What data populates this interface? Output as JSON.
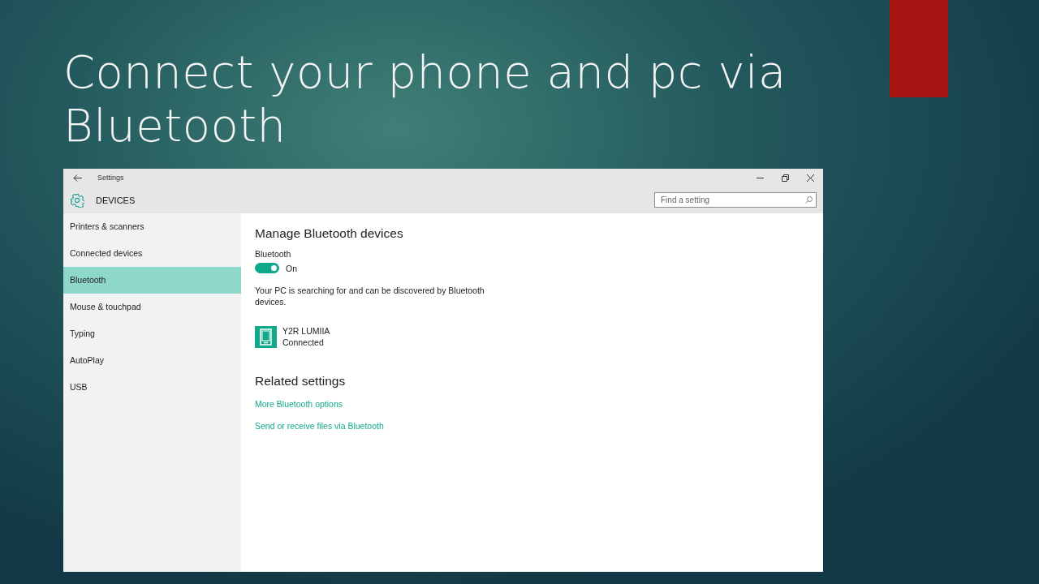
{
  "slide": {
    "title": "Connect your phone and pc via Bluetooth"
  },
  "window": {
    "title": "Settings",
    "section": "DEVICES",
    "search": {
      "placeholder": "Find a setting"
    }
  },
  "sidebar": {
    "items": [
      {
        "label": "Printers & scanners",
        "selected": false
      },
      {
        "label": "Connected devices",
        "selected": false
      },
      {
        "label": "Bluetooth",
        "selected": true
      },
      {
        "label": "Mouse & touchpad",
        "selected": false
      },
      {
        "label": "Typing",
        "selected": false
      },
      {
        "label": "AutoPlay",
        "selected": false
      },
      {
        "label": "USB",
        "selected": false
      }
    ]
  },
  "content": {
    "heading": "Manage Bluetooth devices",
    "toggle": {
      "label": "Bluetooth",
      "on": true,
      "state_text": "On"
    },
    "description": "Your PC is searching for and can be discovered by Bluetooth devices.",
    "devices": [
      {
        "name": "Y2R  LUMIIA",
        "status": "Connected"
      }
    ],
    "related_heading": "Related settings",
    "links": [
      "More Bluetooth options",
      "Send or receive files via Bluetooth"
    ]
  }
}
